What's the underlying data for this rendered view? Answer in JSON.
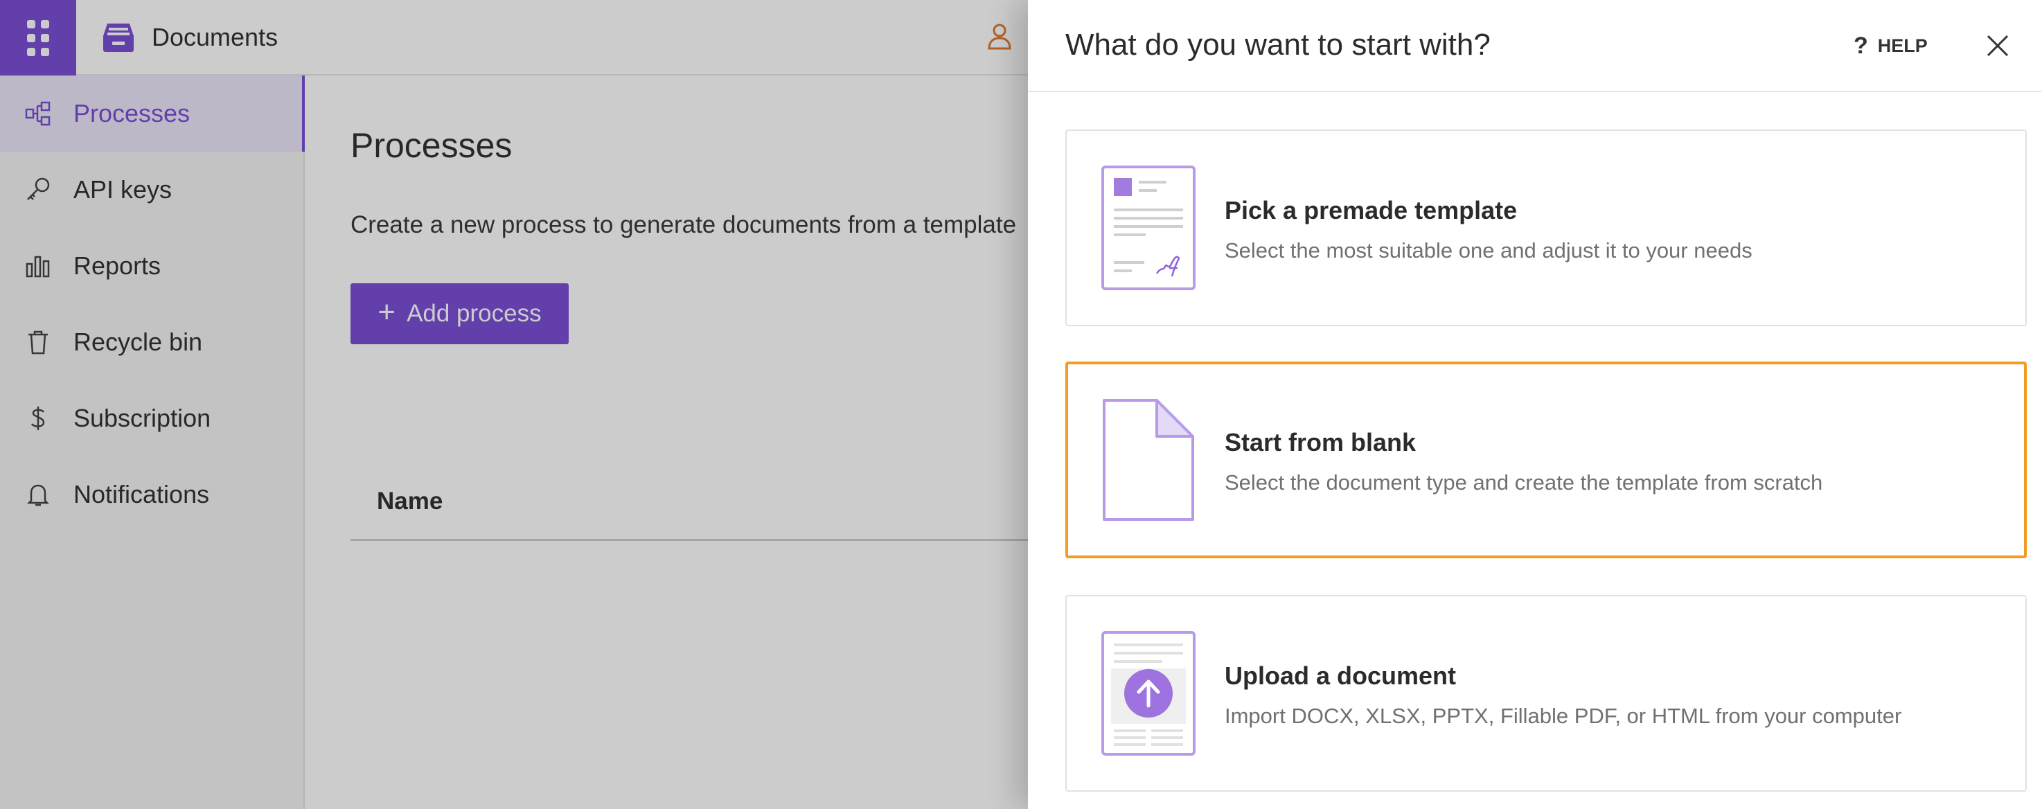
{
  "app": {
    "title": "Documents",
    "apps_icon": "grid-icon",
    "brand_icon": "archive-box-icon",
    "user_icon": "user-icon"
  },
  "sidebar": {
    "items": [
      {
        "label": "Processes",
        "icon": "process-flow-icon",
        "active": true
      },
      {
        "label": "API keys",
        "icon": "key-icon",
        "active": false
      },
      {
        "label": "Reports",
        "icon": "bar-chart-icon",
        "active": false
      },
      {
        "label": "Recycle bin",
        "icon": "trash-icon",
        "active": false
      },
      {
        "label": "Subscription",
        "icon": "dollar-icon",
        "active": false
      },
      {
        "label": "Notifications",
        "icon": "bell-icon",
        "active": false
      }
    ]
  },
  "main": {
    "title": "Processes",
    "description": "Create a new process to generate documents from a template",
    "add_button": "Add process",
    "table": {
      "columns": [
        "Name"
      ]
    }
  },
  "drawer": {
    "title": "What do you want to start with?",
    "help_label": "HELP",
    "close_icon": "close-icon",
    "options": [
      {
        "title": "Pick a premade template",
        "description": "Select the most suitable one and adjust it to your needs",
        "icon": "template-document-icon",
        "selected": false
      },
      {
        "title": "Start from blank",
        "description": "Select the document type and create the template from scratch",
        "icon": "blank-document-icon",
        "selected": true
      },
      {
        "title": "Upload a document",
        "description": "Import DOCX, XLSX, PPTX, Fillable PDF, or HTML from your computer",
        "icon": "upload-document-icon",
        "selected": false
      }
    ]
  },
  "colors": {
    "accent": "#7b4fd6",
    "selection": "#f59a23",
    "accent_light": "#ede6fa"
  }
}
